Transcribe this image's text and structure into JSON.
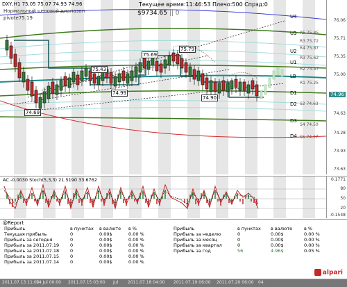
{
  "header": {
    "symbol_line": "DXY,H1 75.05 75.07 74.93 74.96",
    "indicator_name": "Нормальный ценовой диапазон",
    "pivot_label": "pivote75.19",
    "current_time": "Текущее время:11:46:53",
    "leverage": "Плечо:500",
    "spread": "Спрэд:0",
    "balance": "$9734.65",
    "balance_suffix": "|| 0"
  },
  "price_axis": [
    "76.06",
    "75.71",
    "75.35",
    "75.00",
    "74.63",
    "74.28",
    "73.93",
    "73.63"
  ],
  "levels": [
    {
      "name": "U4",
      "price": ""
    },
    {
      "name": "U3",
      "price": ""
    },
    {
      "name": "R5",
      "price": "75.85"
    },
    {
      "name": "R3",
      "price": "75.72"
    },
    {
      "name": "R4",
      "price": "75.87"
    },
    {
      "name": "U2",
      "price": ""
    },
    {
      "name": "R3",
      "price": "75.62"
    },
    {
      "name": "U1",
      "price": ""
    },
    {
      "name": "R2",
      "price": "75.47"
    },
    {
      "name": "LB",
      "price": ""
    },
    {
      "name": "R1",
      "price": "75.25"
    },
    {
      "name": "D1",
      "price": "75.10"
    },
    {
      "name": "D2",
      "price": "74.97"
    },
    {
      "name": "S2",
      "price": "74.63"
    },
    {
      "name": "D3",
      "price": ""
    },
    {
      "name": "S4",
      "price": "74.50"
    },
    {
      "name": "D4",
      "price": ""
    },
    {
      "name": "S5",
      "price": "74.27"
    }
  ],
  "current_price": "74.96",
  "price_boxes": [
    "75.43",
    "75.69",
    "75.79",
    "74.99",
    "74.90",
    "74.69"
  ],
  "oscillator": {
    "title": "AC -0.0030",
    "stoch": "Stoch(5,3,3) 21.5190 33.6762",
    "axis": [
      "0.1771",
      "80",
      "50",
      "20",
      "-0.1548"
    ]
  },
  "report": {
    "title": "@Report",
    "left_headers": [
      "Прибыль",
      "в пунктах",
      "в валюте",
      "в %"
    ],
    "left_rows": [
      [
        "Текущая прибыль",
        "0",
        "0.00$",
        "0.00 %"
      ],
      [
        "Прибыль за сегодня",
        "0",
        "0.00$",
        "0.00 %"
      ],
      [
        "Прибыль за 2011.07.19",
        "0",
        "0.00$",
        "0.00 %"
      ],
      [
        "Прибыль за 2011.07.18",
        "0",
        "0.00$",
        "0.00 %"
      ],
      [
        "Прибыль за 2011.07.15",
        "0",
        "0.00$",
        "0.00 %"
      ],
      [
        "Прибыль за 2011.07.14",
        "0",
        "0.00$",
        "0.00 %"
      ]
    ],
    "right_headers": [
      "Прибыль",
      "в пунктах",
      "в валюте",
      "в %"
    ],
    "right_rows": [
      [
        "Прибыль за неделю",
        "0",
        "0.00$",
        "0.00 %"
      ],
      [
        "Прибыль за месяц",
        "0",
        "0.00$",
        "0.00 %"
      ],
      [
        "Прибыль за квартал",
        "0",
        "0.00$",
        "0.00 %"
      ],
      [
        "Прибыль за год",
        "56",
        "4.96$",
        "0.05 %"
      ]
    ],
    "brand": "alpari"
  },
  "time_axis": [
    "2011.07.13 11:00",
    "14 Jul 00:00",
    "2011.07.15 03:00",
    "Jul",
    "2011.07.18 04:00",
    "2011.07.19 06:00",
    "2011.07.20 06:00",
    "04"
  ]
}
